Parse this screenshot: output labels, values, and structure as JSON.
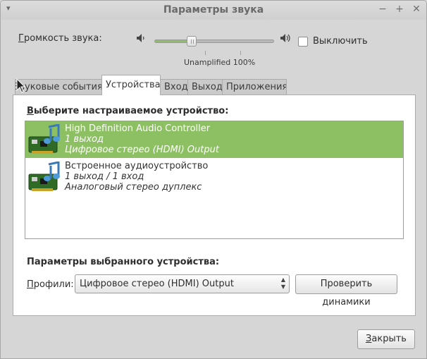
{
  "window": {
    "title": "Параметры звука",
    "menu_glyph": "▾",
    "minimize_glyph": "−",
    "maximize_glyph": "+",
    "close_glyph": "✕"
  },
  "volume": {
    "label_prefix": "Г",
    "label_rest": "ромкость звука:",
    "level_percent": 100,
    "slider_fraction": 0.33,
    "caption": "Unamplified 100%",
    "mute_label": "Выключить",
    "mute_checked": false
  },
  "tabs": [
    {
      "label": "Звуковые события",
      "active": false
    },
    {
      "label": "Устройства",
      "active": true
    },
    {
      "label": "Вход",
      "active": false
    },
    {
      "label": "Выход",
      "active": false
    },
    {
      "label": "Приложения",
      "active": false
    }
  ],
  "devices_page": {
    "title_prefix": "В",
    "title_rest": "ыберите настраиваемое устройство:",
    "devices": [
      {
        "name": "High Definition Audio Controller",
        "ports": "1 выход",
        "profile": "Цифровое стерео (HDMI) Output",
        "selected": true
      },
      {
        "name": "Встроенное аудиоустройство",
        "ports": "1 выход / 1 вход",
        "profile": "Аналоговый стерео дуплекс",
        "selected": false
      }
    ],
    "section_title": "Параметры выбранного устройства:",
    "profile_label_prefix": "П",
    "profile_label_rest": "рофили:",
    "profile_value": "Цифровое стерео (HDMI) Output",
    "test_button": "Проверить динамики"
  },
  "footer": {
    "close_prefix": "З",
    "close_rest": "акрыть"
  },
  "colors": {
    "accent": "#8dc063",
    "window_bg": "#d6d6d6"
  }
}
